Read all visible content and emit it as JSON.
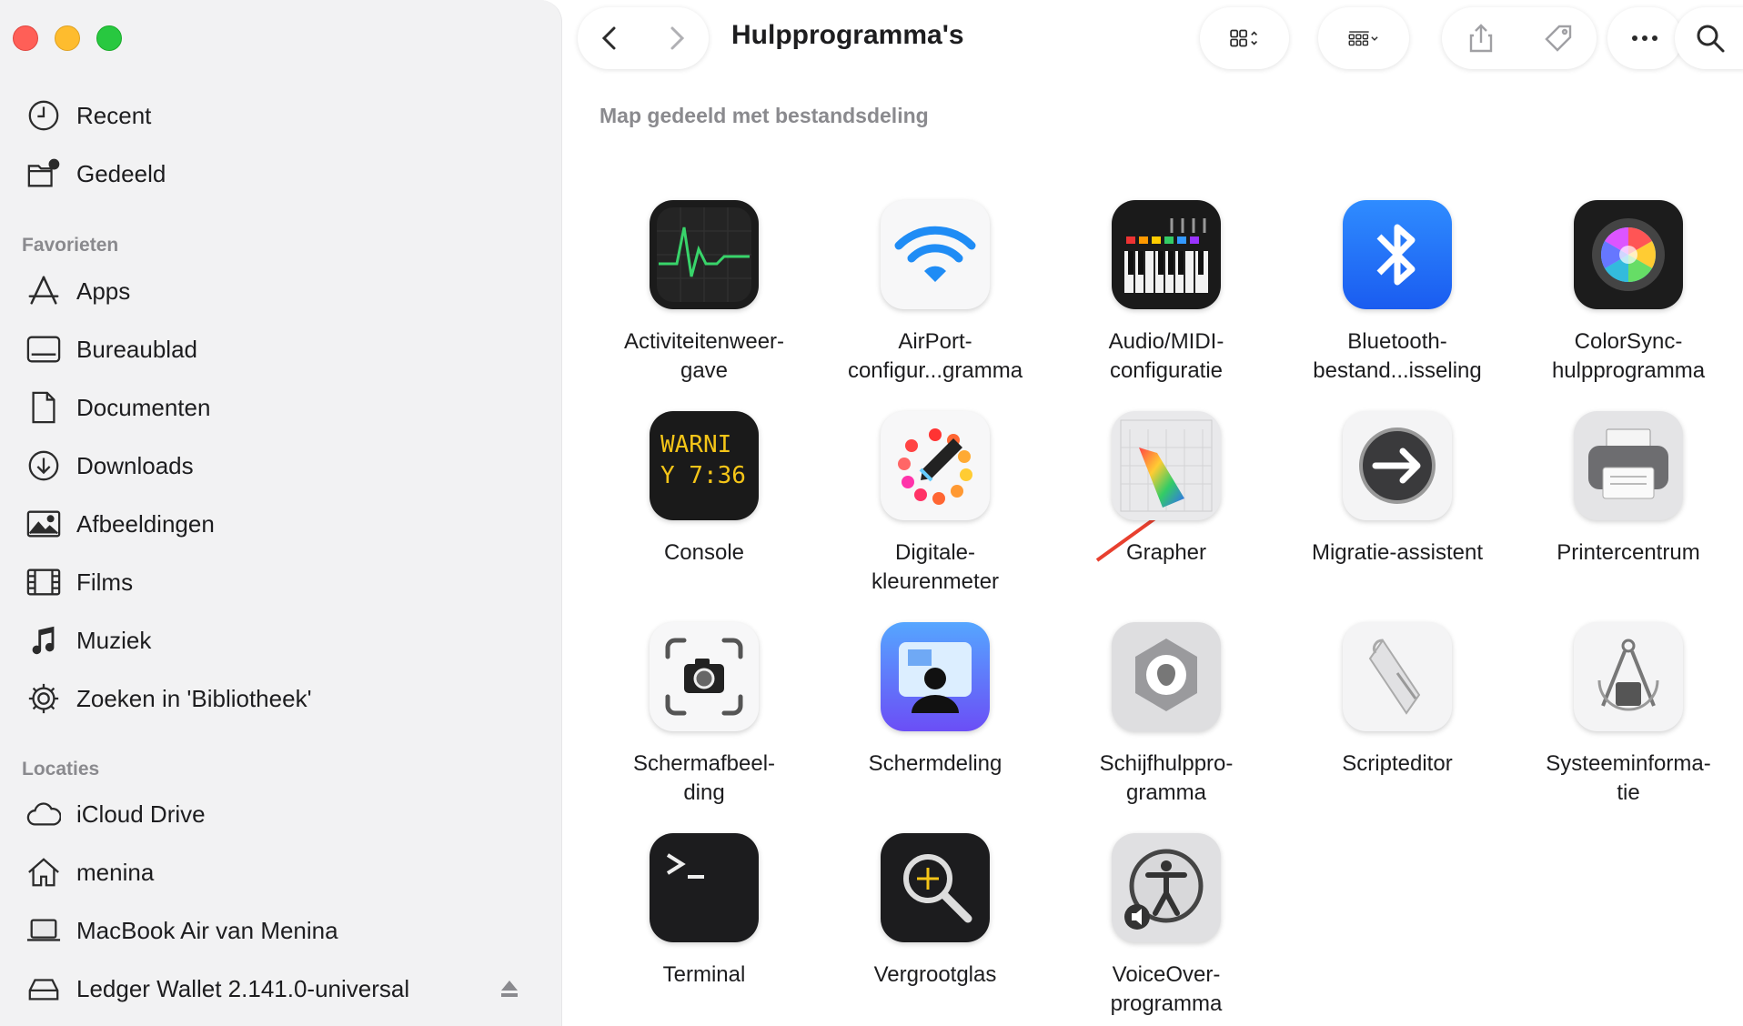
{
  "window": {
    "title": "Hulpprogramma's"
  },
  "sidebar": {
    "top_items": [
      {
        "label": "Recent",
        "icon": "clock-icon"
      },
      {
        "label": "Gedeeld",
        "icon": "shared-folder-icon"
      }
    ],
    "favorites_heading": "Favorieten",
    "favorites": [
      {
        "label": "Apps",
        "icon": "apps-icon"
      },
      {
        "label": "Bureaublad",
        "icon": "desktop-icon"
      },
      {
        "label": "Documenten",
        "icon": "document-icon"
      },
      {
        "label": "Downloads",
        "icon": "download-icon"
      },
      {
        "label": "Afbeeldingen",
        "icon": "pictures-icon"
      },
      {
        "label": "Films",
        "icon": "film-icon"
      },
      {
        "label": "Muziek",
        "icon": "music-icon"
      },
      {
        "label": "Zoeken in 'Bibliotheek'",
        "icon": "gear-icon"
      }
    ],
    "locations_heading": "Locaties",
    "locations": [
      {
        "label": "iCloud Drive",
        "icon": "cloud-icon"
      },
      {
        "label": "menina",
        "icon": "home-icon"
      },
      {
        "label": "MacBook Air van Menina",
        "icon": "laptop-icon"
      },
      {
        "label": "Ledger Wallet 2.141.0-universal",
        "icon": "disk-icon"
      }
    ]
  },
  "main": {
    "subtitle": "Map gedeeld met bestandsdeling",
    "apps": [
      {
        "label": "Activiteitenweer-\ngave",
        "icon": "activity-monitor-icon"
      },
      {
        "label": "AirPort-\nconfigur...gramma",
        "icon": "airport-utility-icon"
      },
      {
        "label": "Audio/MIDI-\nconfiguratie",
        "icon": "audio-midi-icon"
      },
      {
        "label": "Bluetooth-\nbestand...isseling",
        "icon": "bluetooth-icon"
      },
      {
        "label": "ColorSync-\nhulpprogramma",
        "icon": "colorsync-icon"
      },
      {
        "label": "Console",
        "icon": "console-icon",
        "icon_text_1": "WARNI",
        "icon_text_2": "Y 7:36"
      },
      {
        "label": "Digitale-\nkleurenmeter",
        "icon": "color-meter-icon"
      },
      {
        "label": "Grapher",
        "icon": "grapher-icon"
      },
      {
        "label": "Migratie-assistent",
        "icon": "migration-icon"
      },
      {
        "label": "Printercentrum",
        "icon": "printer-icon"
      },
      {
        "label": "Schermafbeel-\nding",
        "icon": "screenshot-icon"
      },
      {
        "label": "Schermdeling",
        "icon": "screen-sharing-icon"
      },
      {
        "label": "Schijfhulppro-\ngramma",
        "icon": "disk-utility-icon"
      },
      {
        "label": "Scripteditor",
        "icon": "script-editor-icon"
      },
      {
        "label": "Systeeminforma-\ntie",
        "icon": "system-info-icon"
      },
      {
        "label": "Terminal",
        "icon": "terminal-icon"
      },
      {
        "label": "Vergrootglas",
        "icon": "magnifier-icon"
      },
      {
        "label": "VoiceOver-\nprogramma",
        "icon": "voiceover-icon"
      }
    ]
  },
  "colors": {
    "accent": "#e8402f",
    "sidebar_bg": "#f2f2f3"
  }
}
